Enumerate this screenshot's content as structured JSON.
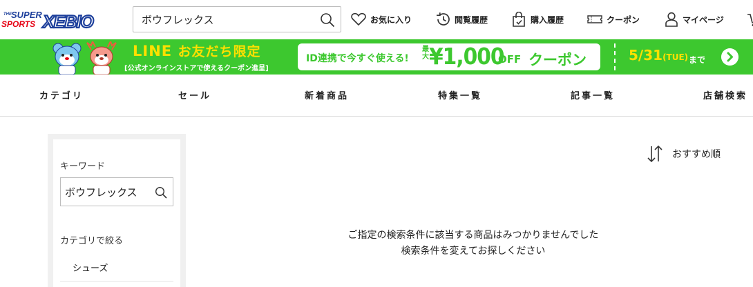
{
  "header": {
    "logo_text": "SUPER SPORTS XEBIO",
    "search": {
      "value": "ボウフレックス",
      "placeholder": ""
    },
    "nav": {
      "favorites": "お気に入り",
      "history": "閲覧履歴",
      "purchase": "購入履歴",
      "coupon": "クーポン",
      "mypage": "マイページ"
    }
  },
  "banner": {
    "title_line": "LINE",
    "title_rest": "お友だち限定",
    "sub": "[公式オンラインストアで使えるクーポン進呈]",
    "pill_text": "ID連携で今すぐ使える!",
    "max_label": "最大",
    "amount": "¥1,000",
    "off": "OFF",
    "coupon": "クーポン",
    "date": "5/31",
    "date_day": "(TUE)",
    "until": "まで",
    "colors": {
      "background": "#3dc82f",
      "accent": "#ffe000"
    }
  },
  "catnav": {
    "items": [
      "カテゴリ",
      "セール",
      "新着商品",
      "特集一覧",
      "記事一覧",
      "店舗検索"
    ]
  },
  "sidebar": {
    "keyword_label": "キーワード",
    "keyword_value": "ボウフレックス",
    "category_label": "カテゴリで絞る",
    "categories": [
      "シューズ"
    ]
  },
  "main": {
    "sort_label": "おすすめ順",
    "noresult_line1": "ご指定の検索条件に該当する商品はみつかりませんでした",
    "noresult_line2": "検索条件を変えてお探しください"
  }
}
